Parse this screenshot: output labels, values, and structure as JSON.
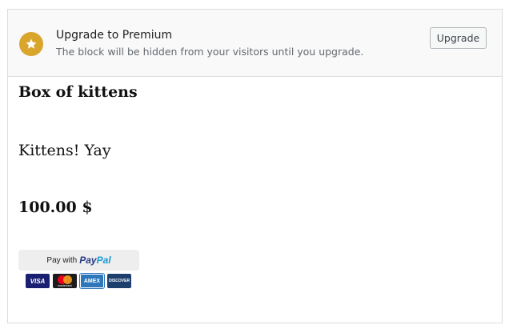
{
  "notice": {
    "icon": "star-icon",
    "icon_color": "#d9a52b",
    "title": "Upgrade to Premium",
    "text": "The block will be hidden from your visitors until you upgrade.",
    "button_label": "Upgrade"
  },
  "product": {
    "title": "Box of kittens",
    "description": "Kittens! Yay",
    "price": "100.00 $"
  },
  "paypal": {
    "pay_with": "Pay with",
    "logo_part1": "Pay",
    "logo_part2": "Pal",
    "cards": [
      {
        "name": "VISA",
        "icon": "visa-icon"
      },
      {
        "name": "mastercard",
        "icon": "mastercard-icon"
      },
      {
        "name": "AMEX",
        "icon": "amex-icon"
      },
      {
        "name": "DISCOVER",
        "icon": "discover-icon"
      }
    ]
  }
}
